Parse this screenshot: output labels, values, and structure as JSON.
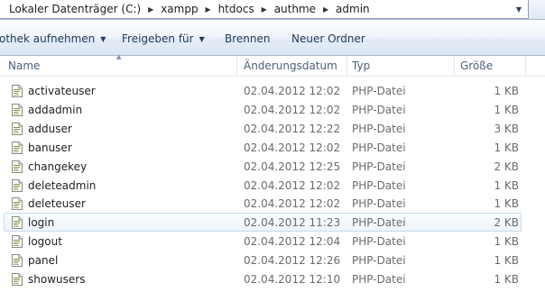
{
  "address_bar": {
    "crumbs": [
      "Lokaler Datenträger (C:)",
      "xampp",
      "htdocs",
      "authme",
      "admin"
    ]
  },
  "toolbar": {
    "library_label": "othek aufnehmen",
    "share_label": "Freigeben für",
    "burn_label": "Brennen",
    "new_folder_label": "Neuer Ordner"
  },
  "columns": {
    "name": "Name",
    "date": "Änderungsdatum",
    "type": "Typ",
    "size": "Größe"
  },
  "files": [
    {
      "name": "activateuser",
      "date": "02.04.2012 12:02",
      "type": "PHP-Datei",
      "size": "1 KB"
    },
    {
      "name": "addadmin",
      "date": "02.04.2012 12:02",
      "type": "PHP-Datei",
      "size": "1 KB"
    },
    {
      "name": "adduser",
      "date": "02.04.2012 12:22",
      "type": "PHP-Datei",
      "size": "3 KB"
    },
    {
      "name": "banuser",
      "date": "02.04.2012 12:02",
      "type": "PHP-Datei",
      "size": "1 KB"
    },
    {
      "name": "changekey",
      "date": "02.04.2012 12:25",
      "type": "PHP-Datei",
      "size": "2 KB"
    },
    {
      "name": "deleteadmin",
      "date": "02.04.2012 12:02",
      "type": "PHP-Datei",
      "size": "1 KB"
    },
    {
      "name": "deleteuser",
      "date": "02.04.2012 12:02",
      "type": "PHP-Datei",
      "size": "1 KB"
    },
    {
      "name": "login",
      "date": "02.04.2012 11:23",
      "type": "PHP-Datei",
      "size": "2 KB"
    },
    {
      "name": "logout",
      "date": "02.04.2012 12:04",
      "type": "PHP-Datei",
      "size": "1 KB"
    },
    {
      "name": "panel",
      "date": "02.04.2012 12:26",
      "type": "PHP-Datei",
      "size": "1 KB"
    },
    {
      "name": "showusers",
      "date": "02.04.2012 12:10",
      "type": "PHP-Datei",
      "size": "1 KB"
    }
  ],
  "selected_file": "login",
  "icons": {
    "breadcrumb_separator": "chevron-right-icon",
    "address_dropdown": "chevron-down-icon",
    "toolbar_dropdown": "caret-down-icon",
    "sort": "sort-ascending-icon",
    "file": "php-file-icon"
  },
  "colors": {
    "toolbar_text": "#1e395b",
    "header_text": "#4c607a",
    "selection_border": "#c6d9f0",
    "secondary_text": "#6b6b6b"
  }
}
